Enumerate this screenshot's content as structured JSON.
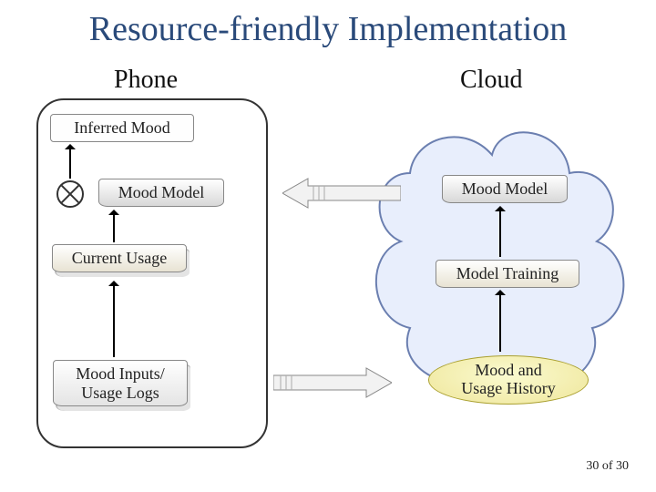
{
  "title": "Resource-friendly Implementation",
  "columns": {
    "left": "Phone",
    "right": "Cloud"
  },
  "phone": {
    "inferred": "Inferred Mood",
    "model": "Mood Model",
    "usage": "Current Usage",
    "logs": "Mood Inputs/\nUsage Logs"
  },
  "cloud": {
    "model": "Mood Model",
    "training": "Model Training",
    "history": "Mood and\nUsage History"
  },
  "footer": "30 of 30"
}
